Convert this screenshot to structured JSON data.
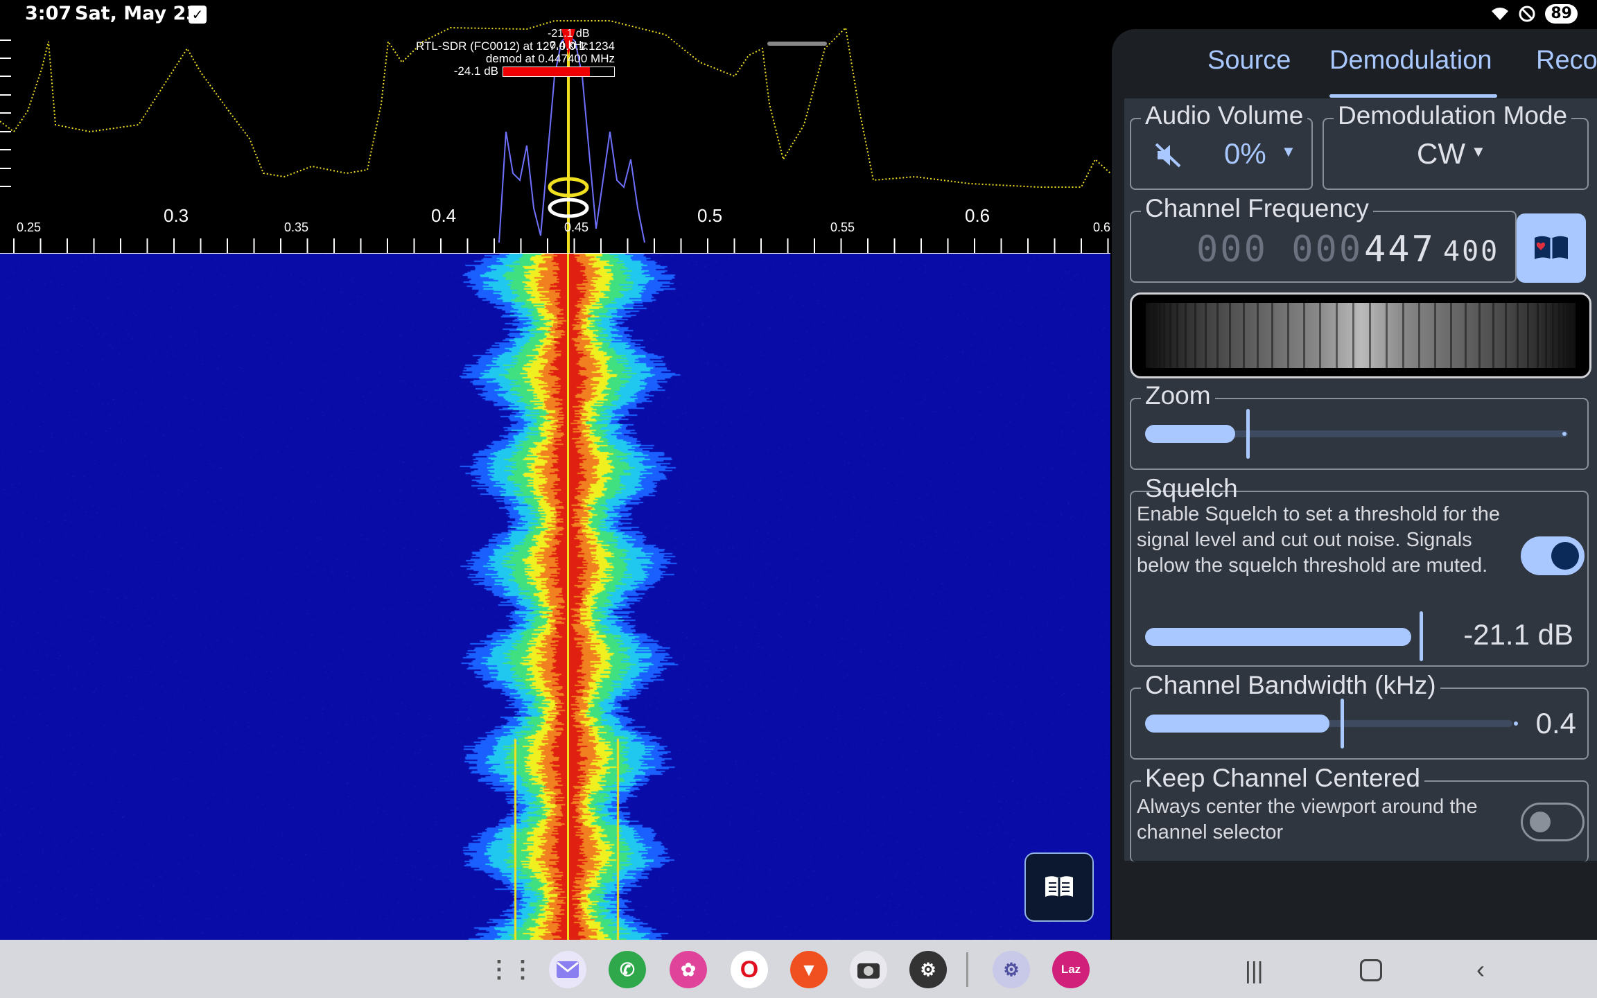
{
  "status_bar": {
    "time": "3:07",
    "date": "Sat, May 23",
    "battery": "89"
  },
  "spectrum": {
    "device_line": "RTL-SDR (FC0012) at 127.0.0.1:1234",
    "demod_line": "demod at 0.447400 MHz",
    "db_readout": "-24.1 dB",
    "channel_db": "-21.1 dB",
    "channel_bw": "0.4 kHz",
    "ticks": [
      {
        "label": "0.25",
        "size": "small"
      },
      {
        "label": "0.3",
        "size": "large"
      },
      {
        "label": "0.35",
        "size": "small"
      },
      {
        "label": "0.4",
        "size": "large"
      },
      {
        "label": "0.45",
        "size": "small"
      },
      {
        "label": "0.5",
        "size": "large"
      },
      {
        "label": "0.55",
        "size": "small"
      },
      {
        "label": "0.6",
        "size": "large"
      },
      {
        "label": "0.6",
        "size": "small"
      }
    ]
  },
  "tabs": [
    "Source",
    "Demodulation",
    "Reco"
  ],
  "active_tab": "Demodulation",
  "audio_volume": {
    "label": "Audio Volume",
    "value": "0%"
  },
  "demod_mode": {
    "label": "Demodulation Mode",
    "value": "CW"
  },
  "channel_frequency": {
    "label": "Channel Frequency",
    "dim": "000 000",
    "main": "447",
    "small": "400"
  },
  "zoom": {
    "label": "Zoom",
    "level": 0.18
  },
  "squelch": {
    "label": "Squelch",
    "description": "Enable Squelch to set a threshold for the signal level and cut out noise. Signals below the squelch threshold are muted.",
    "enabled": true,
    "value": "-21.1 dB",
    "level": 0.62
  },
  "channel_bandwidth": {
    "label": "Channel Bandwidth (kHz)",
    "value": "0.4",
    "level": 0.5
  },
  "keep_centered": {
    "label": "Keep Channel Centered",
    "description": "Always center the viewport around the channel selector",
    "enabled": false
  },
  "colors": {
    "accent": "#a8c8ff",
    "panel": "#30363f",
    "waterfall_bg": "#0a0ca8",
    "spectrum_trace": "#f0e020"
  },
  "dock_apps": [
    "app-drawer-icon",
    "mail-icon",
    "phone-icon",
    "gallery-icon",
    "opera-icon",
    "brave-icon",
    "camera-icon",
    "settings-icon",
    "galaxy-store-icon",
    "lazada-icon"
  ]
}
